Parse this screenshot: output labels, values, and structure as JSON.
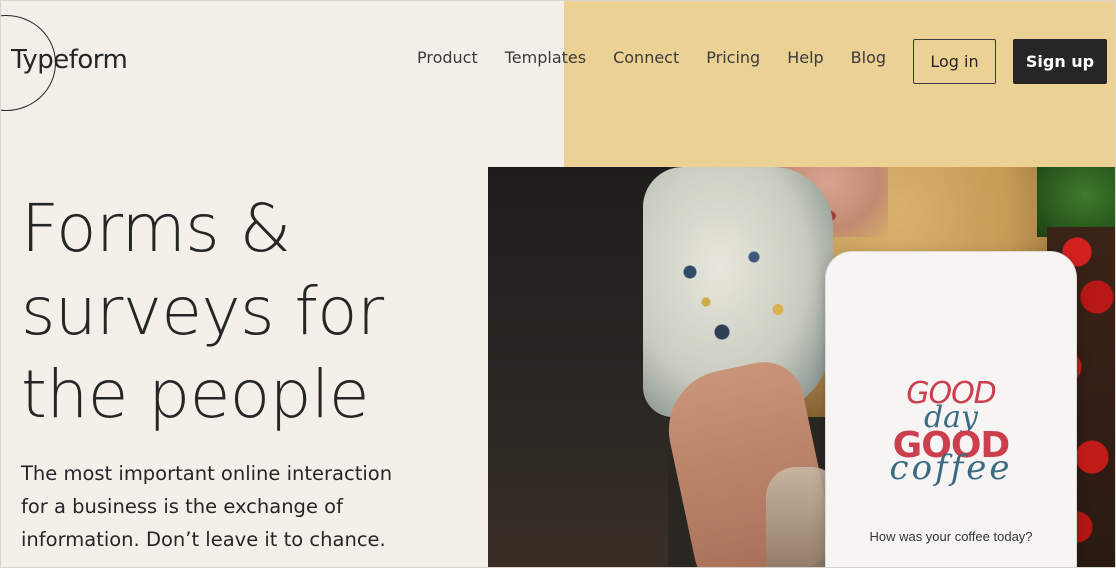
{
  "brand": {
    "logo_text": "Typeform"
  },
  "nav": {
    "items": [
      {
        "label": "Product"
      },
      {
        "label": "Templates"
      },
      {
        "label": "Connect"
      },
      {
        "label": "Pricing"
      },
      {
        "label": "Help"
      },
      {
        "label": "Blog"
      }
    ],
    "login_label": "Log in",
    "signup_label": "Sign up"
  },
  "hero": {
    "headline_lines": [
      "Forms &",
      "surveys for",
      "the people"
    ],
    "subcopy_lines": [
      "The most important online interaction",
      "for a business is the exchange of",
      "information. Don’t leave it to chance."
    ]
  },
  "phone": {
    "brand_line1": "GOOD",
    "brand_line2": "day",
    "brand_line3": "GOOD",
    "brand_line4": "coffee",
    "question": "How was your coffee today?"
  },
  "colors": {
    "accent_yellow": "#ecd195",
    "background": "#f4efe9",
    "text_dark": "#262626",
    "signup_bg": "#262626",
    "coffee_red": "#cc3f4f",
    "coffee_blue": "#3b6b84"
  }
}
